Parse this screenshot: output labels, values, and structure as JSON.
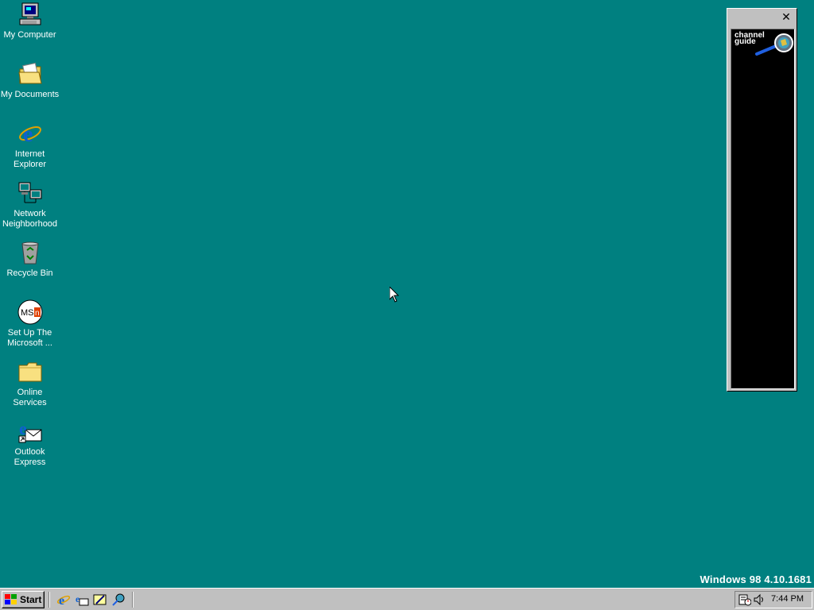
{
  "desktop": {
    "background": "#008080",
    "icons": [
      {
        "name": "my-computer-icon",
        "label": "My Computer"
      },
      {
        "name": "my-documents-icon",
        "label": "My Documents"
      },
      {
        "name": "internet-explorer-icon",
        "label": "Internet Explorer"
      },
      {
        "name": "network-neighborhood-icon",
        "label": "Network Neighborhood"
      },
      {
        "name": "recycle-bin-icon",
        "label": "Recycle Bin"
      },
      {
        "name": "msn-icon",
        "label": "Set Up The Microsoft ..."
      },
      {
        "name": "folder-icon",
        "label": "Online Services"
      },
      {
        "name": "outlook-express-icon",
        "label": "Outlook Express"
      }
    ],
    "version_text": "Windows 98 4.10.1681"
  },
  "channel_bar": {
    "close_label": "✕",
    "guide_label": "channel guide"
  },
  "taskbar": {
    "start_label": "Start",
    "quick_launch": [
      "internet-explorer-icon",
      "outlook-express-icon",
      "show-desktop-icon",
      "view-channels-icon"
    ],
    "clock": "7:44 PM",
    "tray_icons": [
      "task-scheduler-icon",
      "volume-icon"
    ]
  }
}
